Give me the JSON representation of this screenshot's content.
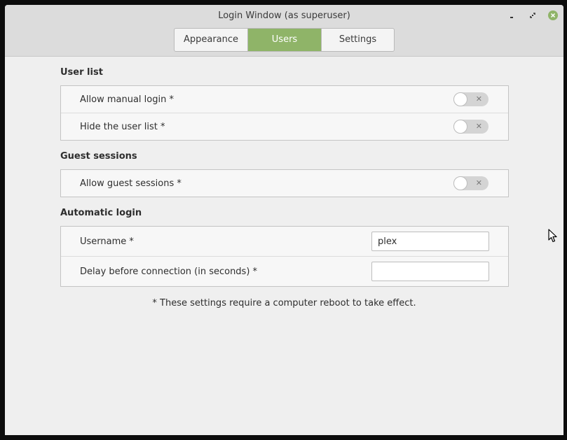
{
  "window": {
    "title": "Login Window (as superuser)"
  },
  "tabs": [
    {
      "label": "Appearance",
      "active": false
    },
    {
      "label": "Users",
      "active": true
    },
    {
      "label": "Settings",
      "active": false
    }
  ],
  "sections": {
    "user_list": {
      "title": "User list",
      "rows": [
        {
          "label": "Allow manual login *",
          "enabled": false
        },
        {
          "label": "Hide the user list *",
          "enabled": false
        }
      ]
    },
    "guest_sessions": {
      "title": "Guest sessions",
      "rows": [
        {
          "label": "Allow guest sessions *",
          "enabled": false
        }
      ]
    },
    "automatic_login": {
      "title": "Automatic login",
      "rows": [
        {
          "label": "Username *",
          "value": "plex"
        },
        {
          "label": "Delay before connection (in seconds) *",
          "value": ""
        }
      ]
    }
  },
  "footnote": "* These settings require a computer reboot to take effect.",
  "colors": {
    "accent": "#8fb468",
    "close_button": "#8fb468"
  }
}
